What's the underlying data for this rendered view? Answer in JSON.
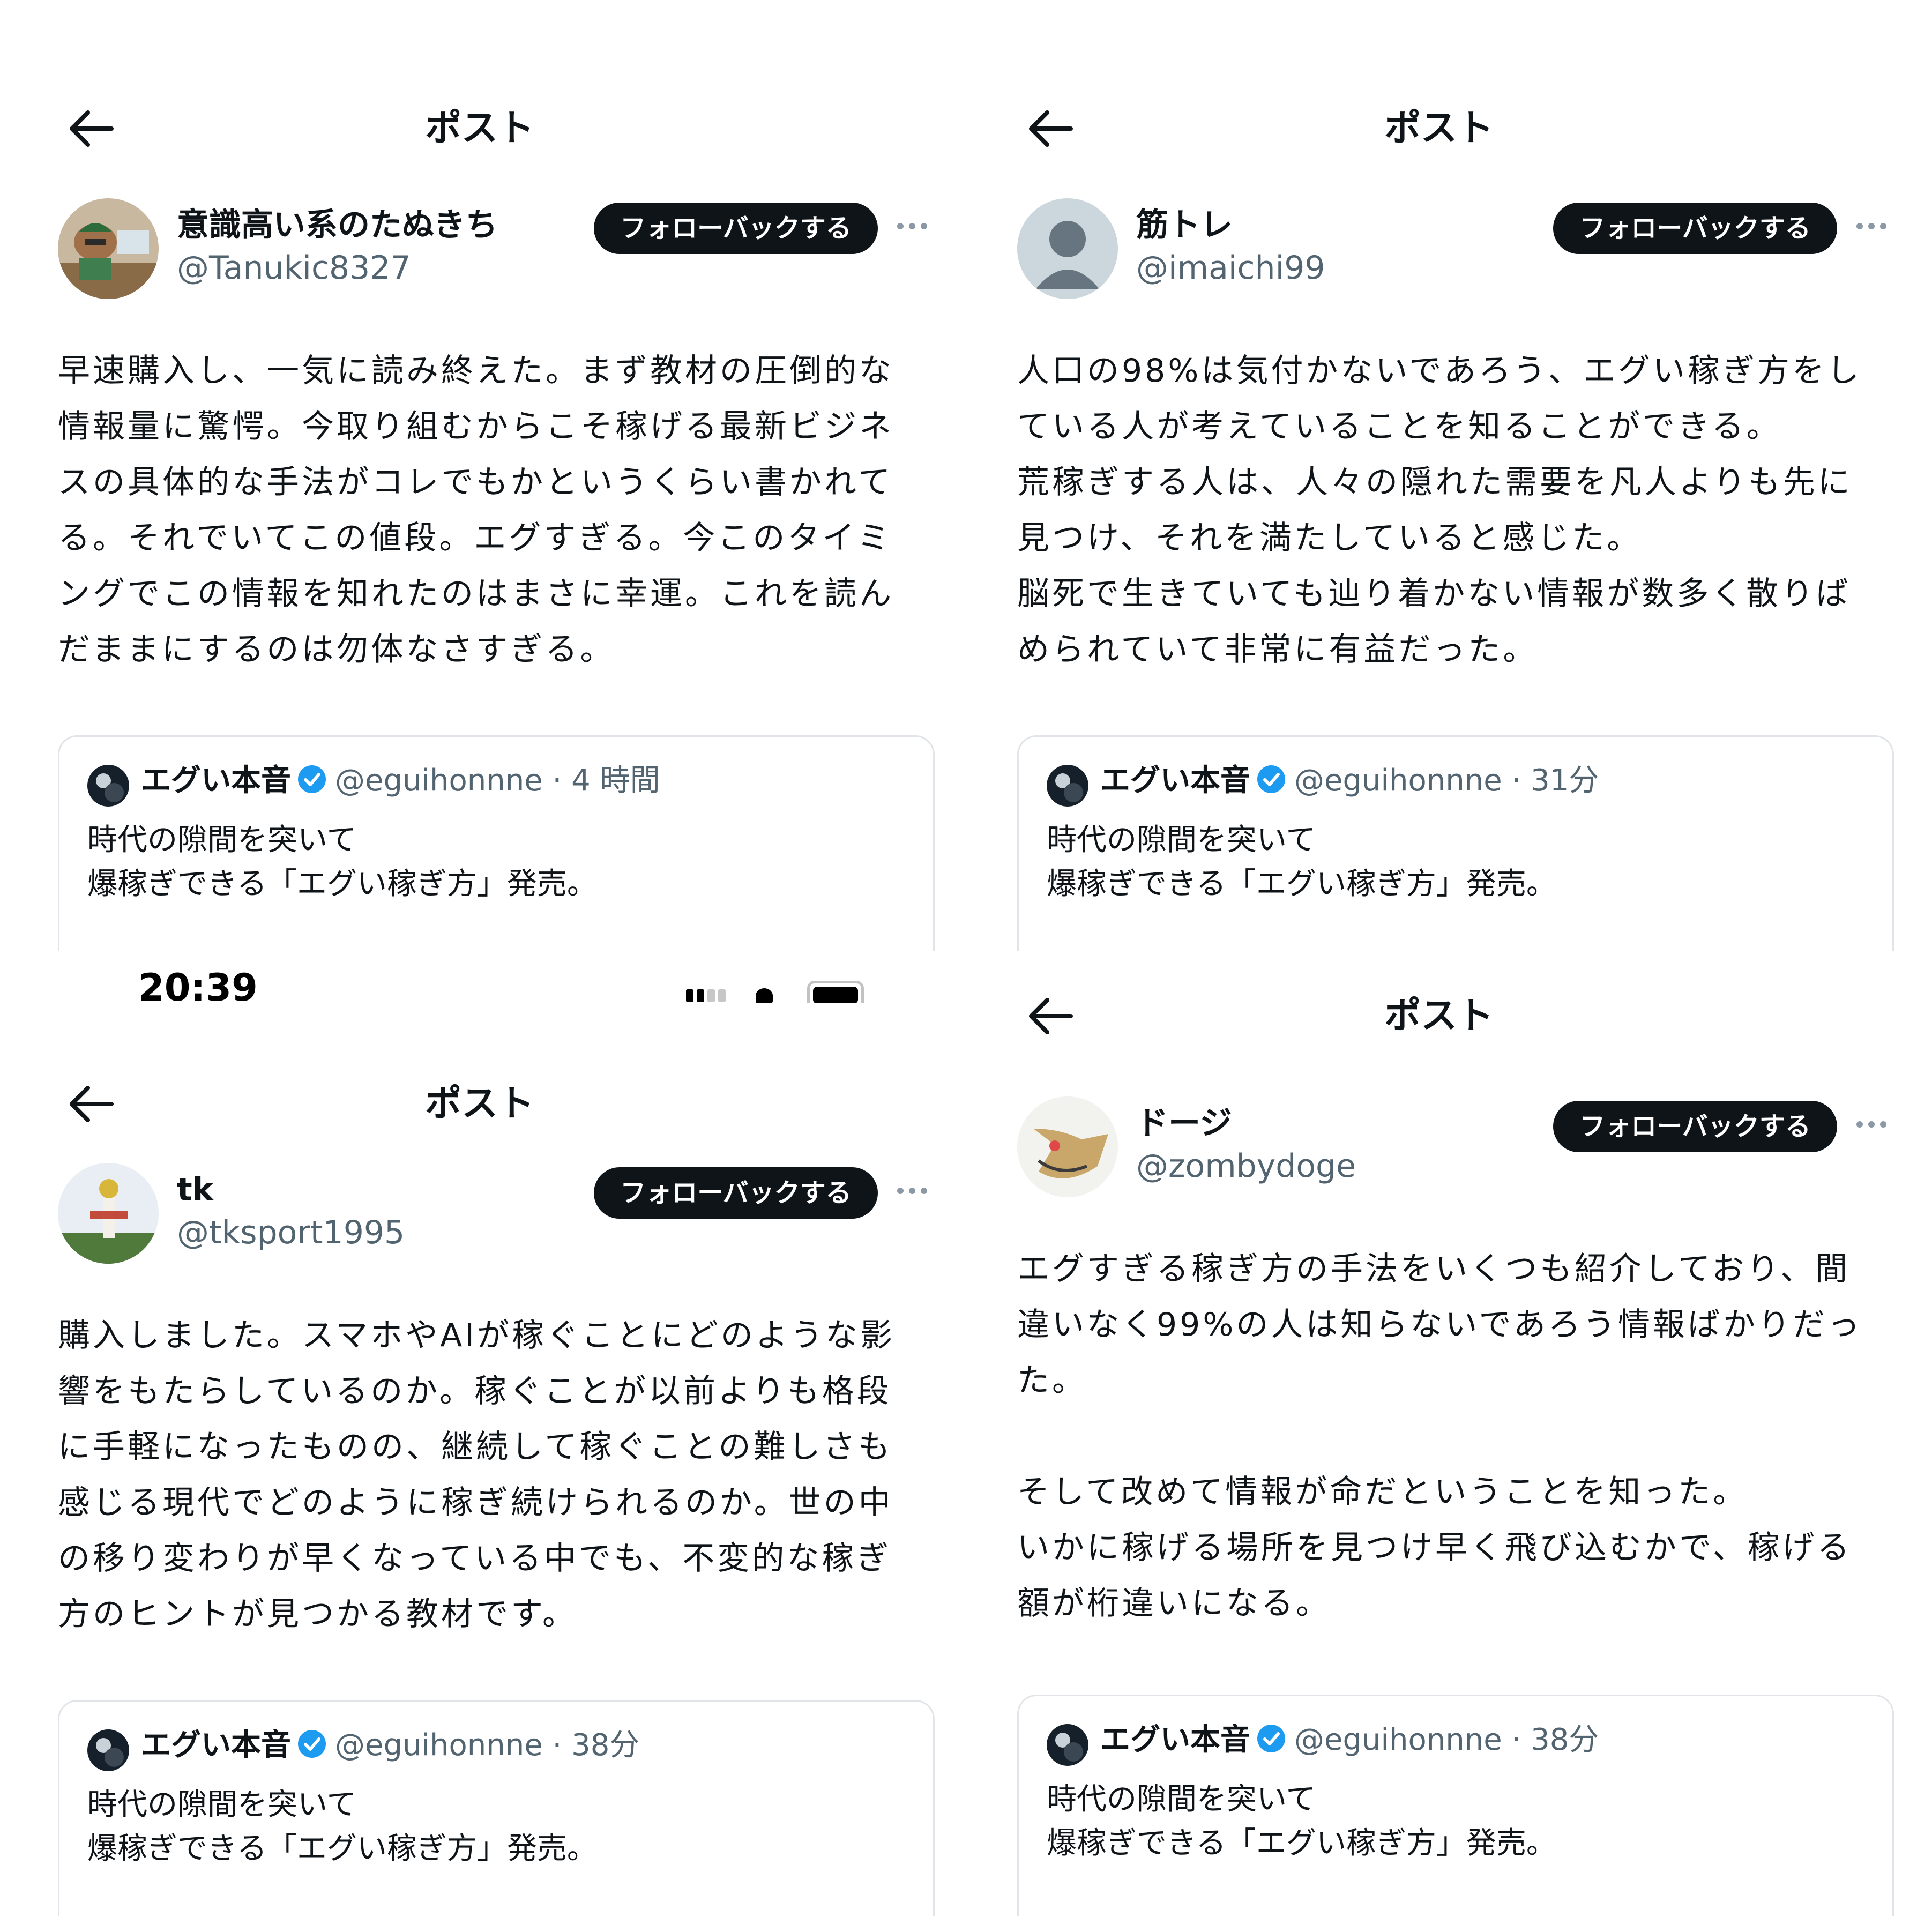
{
  "panels": [
    {
      "status_time": "",
      "header": {
        "title": "ポスト"
      },
      "author": {
        "name": "意識高い系のたぬきち",
        "handle": "@Tanukic8327"
      },
      "follow_label": "フォローバックする",
      "body": "早速購入し、一気に読み終えた。まず教材の圧倒的な\n情報量に驚愕。今取り組むからこそ稼げる最新ビジネ\nスの具体的な手法がコレでもかというくらい書かれて\nる。それでいてこの値段。エグすぎる。今このタイミ\nングでこの情報を知れたのはまさに幸運。これを読ん\nだままにするのは勿体なさすぎる。",
      "quote": {
        "name": "エグい本音",
        "meta": "@eguihonnne · 4 時間",
        "text": "時代の隙間を突いて\n爆稼ぎできる「エグい稼ぎ方」発売。"
      }
    },
    {
      "status_time": "",
      "header": {
        "title": "ポスト"
      },
      "author": {
        "name": "筋トレ",
        "handle": "@imaichi99"
      },
      "follow_label": "フォローバックする",
      "body": "人口の98%は気付かないであろう、エグい稼ぎ方をし\nている人が考えていることを知ることができる。\n荒稼ぎする人は、人々の隠れた需要を凡人よりも先に\n見つけ、それを満たしていると感じた。\n脳死で生きていても辿り着かない情報が数多く散りば\nめられていて非常に有益だった。",
      "quote": {
        "name": "エグい本音",
        "meta": "@eguihonnne · 31分",
        "text": "時代の隙間を突いて\n爆稼ぎできる「エグい稼ぎ方」発売。"
      }
    },
    {
      "status_time": "20:39",
      "header": {
        "title": "ポスト"
      },
      "author": {
        "name": "tk",
        "handle": "@tksport1995"
      },
      "follow_label": "フォローバックする",
      "body": "購入しました。スマホやAIが稼ぐことにどのような影\n響をもたらしているのか。稼ぐことが以前よりも格段\nに手軽になったものの、継続して稼ぐことの難しさも\n感じる現代でどのように稼ぎ続けられるのか。世の中\nの移り変わりが早くなっている中でも、不変的な稼ぎ\n方のヒントが見つかる教材です。",
      "quote": {
        "name": "エグい本音",
        "meta": "@eguihonnne · 38分",
        "text": "時代の隙間を突いて\n爆稼ぎできる「エグい稼ぎ方」発売。"
      }
    },
    {
      "status_time": "",
      "header": {
        "title": "ポスト"
      },
      "author": {
        "name": "ドージ",
        "handle": "@zombydoge"
      },
      "follow_label": "フォローバックする",
      "body": "エグすぎる稼ぎ方の手法をいくつも紹介しており、間\n違いなく99%の人は知らないであろう情報ばかりだっ\nた。\n\nそして改めて情報が命だということを知った。\nいかに稼げる場所を見つけ早く飛び込むかで、稼げる\n額が桁違いになる。",
      "quote": {
        "name": "エグい本音",
        "meta": "@eguihonnne · 38分",
        "text": "時代の隙間を突いて\n爆稼ぎできる「エグい稼ぎ方」発売。"
      }
    }
  ],
  "icons": {
    "back": "arrow-left-icon",
    "more": "more-horizontal-icon",
    "verified": "verified-badge-icon",
    "signal": "cellular-signal-icon",
    "wifi": "wifi-icon",
    "battery": "battery-icon"
  },
  "colors": {
    "follow_bg": "#0f1419",
    "verified": "#1d9bf0",
    "secondary_text": "#536471",
    "card_border": "#e1e4e8"
  }
}
